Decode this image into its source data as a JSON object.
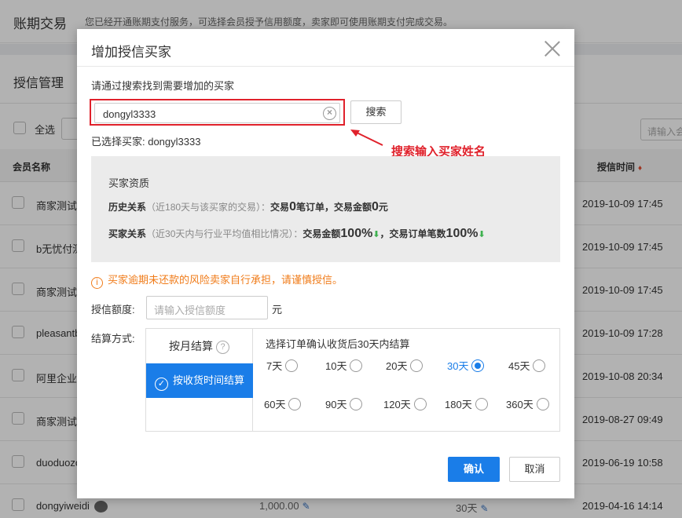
{
  "page": {
    "title": "账期交易",
    "description": "您已经开通账期支付服务，可选择会员授予信用额度，卖家即可使用账期支付完成交易。",
    "section_title": "授信管理",
    "select_all": "全选",
    "search_placeholder": "请输入会"
  },
  "table": {
    "headers": {
      "name": "会员名称",
      "time": "授信时间",
      "sort_icon": "sort-desc-icon"
    },
    "rows": [
      {
        "name": "商家测试",
        "time": "2019-10-09 17:45"
      },
      {
        "name": "b无忧付测",
        "time": "2019-10-09 17:45"
      },
      {
        "name": "商家测试",
        "time": "2019-10-09 17:45"
      },
      {
        "name": "pleasantb",
        "time": "2019-10-09 17:28"
      },
      {
        "name": "阿里企业",
        "time": "2019-10-08 20:34"
      },
      {
        "name": "商家测试",
        "time": "2019-08-27 09:49"
      },
      {
        "name": "duoduozo",
        "time": "2019-06-19 10:58"
      },
      {
        "name": "dongyiweidi",
        "amount": "1,000.00",
        "days": "30天",
        "time": "2019-04-16 14:14"
      }
    ]
  },
  "modal": {
    "title": "增加授信买家",
    "search_hint": "请通过搜索找到需要增加的买家",
    "search_value": "dongyl3333",
    "search_button": "搜索",
    "selected_label": "已选择买家: dongyl3333",
    "annotation": "搜索输入买家姓名",
    "accent_color": "#e0212b",
    "qualification": {
      "title": "买家资质",
      "history_label": "历史关系",
      "history_note": "（近180天与该买家的交易）：",
      "history_pre": "交易",
      "history_orders": "0",
      "history_mid": "笔订单，交易金额",
      "history_amount": "0",
      "history_unit": "元",
      "relation_label": "买家关系",
      "relation_note": "（近30天内与行业平均值相比情况）：",
      "amount_label": "交易金额",
      "amount_pct": "100%",
      "orders_label": "，交易订单笔数",
      "orders_pct": "100%"
    },
    "warning": "买家逾期未还款的风险卖家自行承担，请谨慎授信。",
    "limit_label": "授信额度:",
    "limit_placeholder": "请输入授信额度",
    "limit_unit": "元",
    "settle_label": "结算方式:",
    "tab_monthly": "按月结算",
    "tab_receipt": "按收货时间结算",
    "settle_desc": "选择订单确认收货后30天内结算",
    "options": [
      "7天",
      "10天",
      "20天",
      "30天",
      "45天",
      "60天",
      "90天",
      "120天",
      "180天",
      "360天"
    ],
    "selected_option": "30天",
    "primary_color": "#1a7de8",
    "confirm": "确认",
    "cancel": "取消"
  }
}
